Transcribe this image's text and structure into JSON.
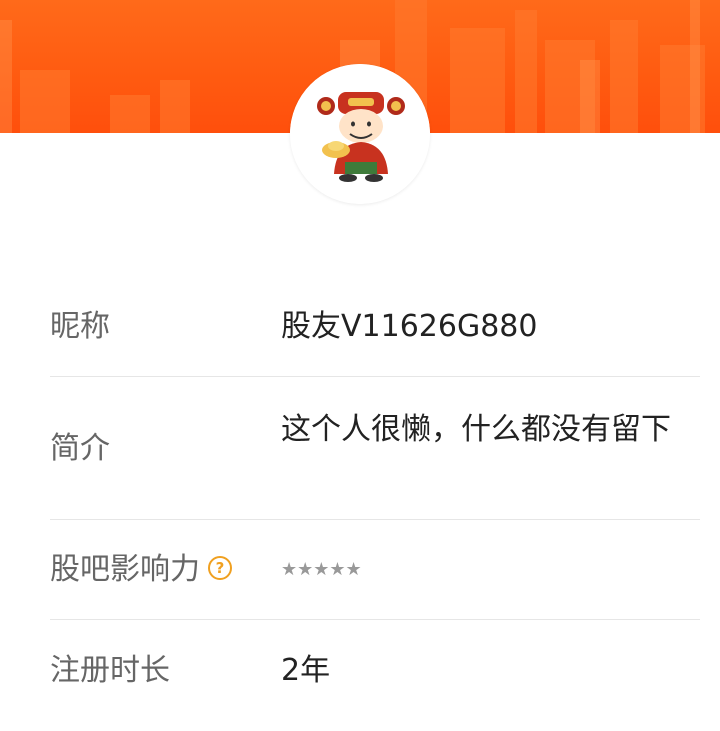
{
  "profile": {
    "banner_color": "#ff5a10",
    "avatar_icon": "caishen-avatar-icon",
    "rows": [
      {
        "label": "昵称",
        "value": "股友V11626G880"
      },
      {
        "label": "简介",
        "value": "这个人很懒，什么都没有留下"
      },
      {
        "label": "股吧影响力",
        "value": "★★★★★",
        "rating": 0,
        "help_icon": "question-circle-icon"
      },
      {
        "label": "注册时长",
        "value": "2年"
      }
    ],
    "help_icon_glyph": "?"
  }
}
